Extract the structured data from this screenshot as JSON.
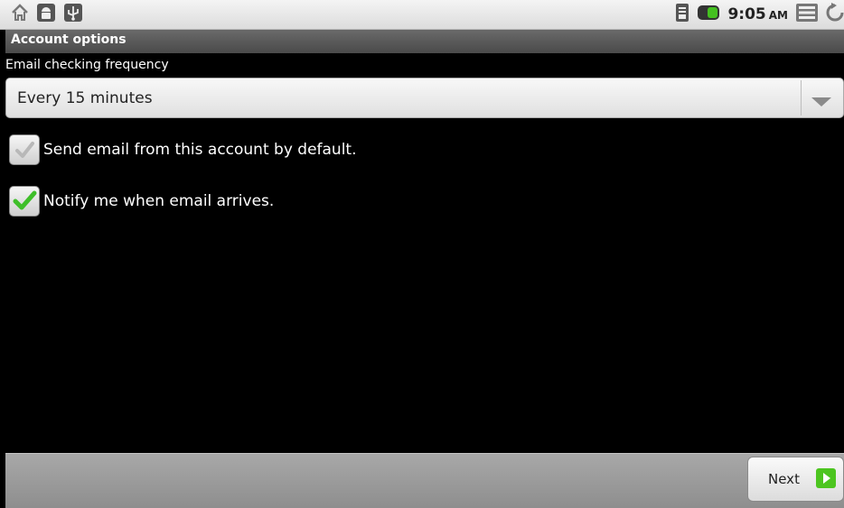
{
  "status_bar": {
    "time": "9:05",
    "ampm": "AM"
  },
  "title_bar": {
    "title": "Account options"
  },
  "frequency": {
    "label": "Email checking frequency",
    "selected": "Every 15 minutes"
  },
  "options": [
    {
      "label": "Send email from this account by default.",
      "checked": false
    },
    {
      "label": "Notify me when email arrives.",
      "checked": true
    }
  ],
  "footer": {
    "next_label": "Next"
  },
  "colors": {
    "check_green": "#3fbf2a",
    "next_arrow_green": "#4cc51f"
  }
}
